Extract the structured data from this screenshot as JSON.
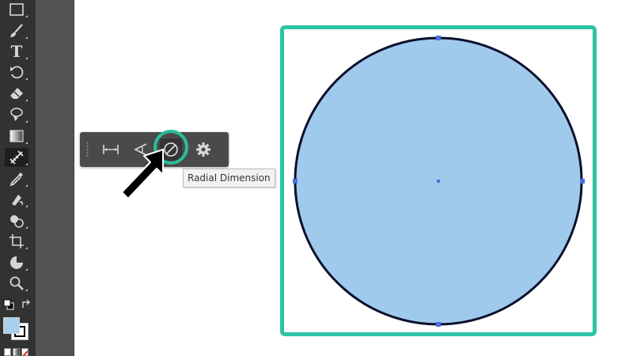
{
  "toolbar": {
    "tools": [
      {
        "icon": "rectangle-tool-icon"
      },
      {
        "icon": "paintbrush-tool-icon"
      },
      {
        "icon": "type-tool-icon",
        "label": "T"
      },
      {
        "icon": "rotate-tool-icon"
      },
      {
        "icon": "eraser-tool-icon"
      },
      {
        "icon": "lasso-tool-icon"
      },
      {
        "icon": "gradient-tool-icon"
      },
      {
        "icon": "dimension-tool-icon",
        "active": true
      },
      {
        "icon": "eyedropper-tool-icon"
      },
      {
        "icon": "live-paint-tool-icon"
      },
      {
        "icon": "shape-builder-tool-icon"
      },
      {
        "icon": "artboard-tool-icon"
      },
      {
        "icon": "pie-chart-tool-icon"
      },
      {
        "icon": "zoom-tool-icon"
      }
    ],
    "fill_color": "#a8d0ee",
    "stroke_color": "#000000"
  },
  "flyout": {
    "buttons": [
      {
        "icon": "linear-dimension-icon"
      },
      {
        "icon": "angular-dimension-icon"
      },
      {
        "icon": "radial-dimension-icon",
        "selected": true
      },
      {
        "icon": "settings-gear-icon"
      }
    ],
    "tooltip": "Radial Dimension"
  },
  "canvas": {
    "selection_color": "#2bc4a4",
    "circle_fill": "#9fcaec",
    "circle_stroke": "#0b0f2a",
    "anchor_color": "#4a6fe3"
  }
}
